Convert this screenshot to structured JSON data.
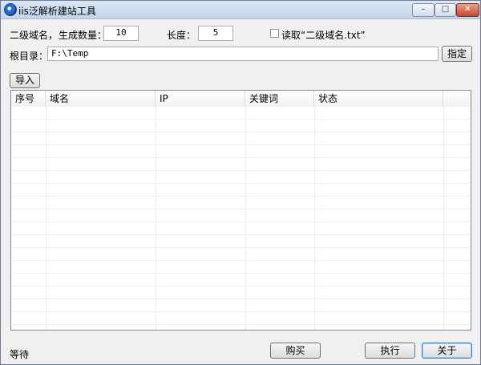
{
  "window": {
    "title": "iis泛解析建站工具",
    "controls": {
      "minimize": "–",
      "maximize": "□",
      "close": "✕"
    }
  },
  "form": {
    "subdomain_label": "二级域名，",
    "count_label": "生成数量：",
    "count_value": "10",
    "length_label": "长度：",
    "length_value": "5",
    "read_file_label": "读取“二级域名.txt”",
    "read_file_checked": false,
    "root_label": "根目录：",
    "root_value": "F:\\Temp",
    "browse_button": "指定",
    "import_button": "导入"
  },
  "table": {
    "columns": [
      "序号",
      "域名",
      "IP",
      "关键词",
      "状态"
    ],
    "rows": []
  },
  "footer": {
    "status_text": "等待",
    "buy_button": "购买",
    "execute_button": "执行",
    "close_button": "关于"
  }
}
